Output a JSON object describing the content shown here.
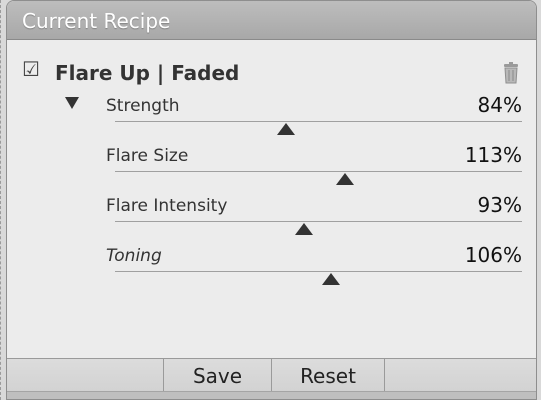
{
  "panel": {
    "title": "Current Recipe"
  },
  "recipe": {
    "checked": true,
    "name": "Flare Up | Faded"
  },
  "params": [
    {
      "label": "Strength",
      "value": "84%",
      "level": 0.84,
      "italic": false
    },
    {
      "label": "Flare Size",
      "value": "113%",
      "level": 1.13,
      "italic": false
    },
    {
      "label": "Flare Intensity",
      "value": "93%",
      "level": 0.93,
      "italic": false
    },
    {
      "label": "Toning",
      "value": "106%",
      "level": 1.06,
      "italic": true
    }
  ],
  "footer": {
    "save_label": "Save",
    "reset_label": "Reset"
  },
  "icons": {
    "check": "checkbox-icon",
    "trash": "trash-icon",
    "expand": "disclosure-triangle-icon"
  },
  "colors": {
    "header": "#b3b3b3",
    "panel_bg": "#ececec",
    "handle": "#333333"
  }
}
